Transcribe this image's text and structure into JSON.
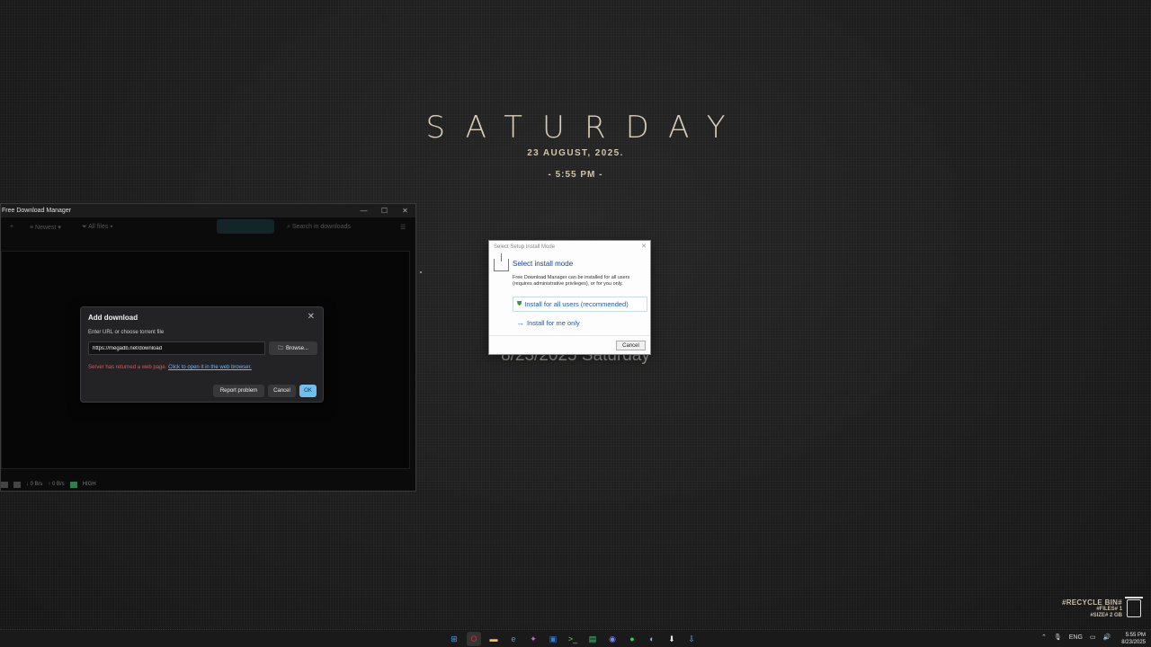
{
  "clock": {
    "day": "SATURDAY",
    "date": "23 AUGUST, 2025.",
    "time": "- 5:55 PM -",
    "date_behind": "8/23/2025 Saturday"
  },
  "fdm": {
    "title": "Free Download Manager",
    "controls": {
      "minimize": "—",
      "maximize": "☐",
      "close": "✕"
    },
    "toolbar": {
      "sort": "Newest",
      "filter": "All files",
      "search_placeholder": "Search in downloads"
    },
    "status": {
      "down": "↓ 0 B/s",
      "up": "↑ 0 B/s",
      "priority": "HIGH"
    }
  },
  "add_download": {
    "title": "Add download",
    "close": "✕",
    "label": "Enter URL or choose torrent file",
    "url_value": "https://megadb.net/download",
    "browse": "Browse...",
    "error_text": "Server has returned a web page.",
    "error_link": "Click to open it in the web browser.",
    "report": "Report problem",
    "cancel": "Cancel",
    "ok": "OK"
  },
  "setup": {
    "title": "Select Setup Install Mode",
    "close": "✕",
    "heading": "Select install mode",
    "description": "Free Download Manager can be installed for all users (requires administrative privileges), or for you only.",
    "option_all": "Install for all users (recommended)",
    "option_me": "Install for me only",
    "cancel": "Cancel"
  },
  "recycle_bin": {
    "title": "#RECYCLE BIN#",
    "files": "#FILES# 1",
    "size": "#SIZE# 2 GB"
  },
  "taskbar": {
    "apps": [
      {
        "name": "start",
        "glyph": "⊞",
        "color": "#3aa0ff"
      },
      {
        "name": "opera",
        "glyph": "O",
        "color": "#e0263a"
      },
      {
        "name": "file-explorer",
        "glyph": "▬",
        "color": "#f2c14e"
      },
      {
        "name": "edge",
        "glyph": "e",
        "color": "#2fa5d8"
      },
      {
        "name": "copilot",
        "glyph": "✦",
        "color": "#c86ad6"
      },
      {
        "name": "store",
        "glyph": "▣",
        "color": "#2f7de0"
      },
      {
        "name": "terminal",
        "glyph": ">_",
        "color": "#7ac27a"
      },
      {
        "name": "app-green",
        "glyph": "▤",
        "color": "#3fd37a"
      },
      {
        "name": "discord",
        "glyph": "◉",
        "color": "#7d86f0"
      },
      {
        "name": "spotify",
        "glyph": "●",
        "color": "#1ed760"
      },
      {
        "name": "steam",
        "glyph": "◐",
        "color": "#9fb8d6"
      },
      {
        "name": "setup",
        "glyph": "⬇",
        "color": "#e8e8e8"
      },
      {
        "name": "fdm",
        "glyph": "⇩",
        "color": "#5fb0ff"
      }
    ],
    "language": "ENG",
    "time": "5:55 PM",
    "date": "8/23/2025"
  }
}
